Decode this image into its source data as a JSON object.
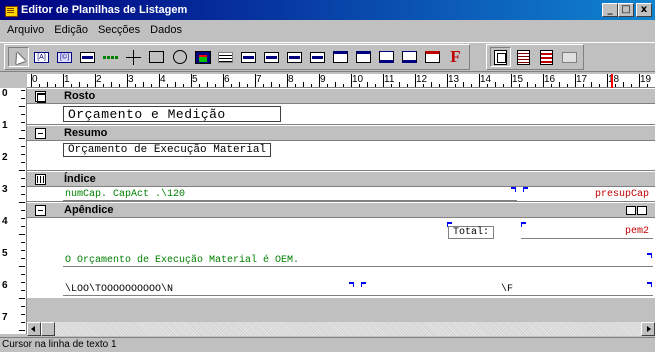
{
  "window": {
    "title": "Editor de Planilhas de Listagem",
    "minimize": "_",
    "maximize": "□",
    "close": "x"
  },
  "menu": [
    "Arquivo",
    "Edição",
    "Secções",
    "Dados"
  ],
  "toolbar": {
    "label_tool": "[A]",
    "field_tool": "[©]",
    "font_letter": "F"
  },
  "ruler": {
    "numbers": [
      "0",
      "1",
      "2",
      "3",
      "4",
      "5",
      "6",
      "7",
      "8",
      "9",
      "10",
      "11",
      "12",
      "13",
      "14",
      "15",
      "16",
      "17",
      "18",
      "19"
    ]
  },
  "vruler": {
    "numbers": [
      "0",
      "1",
      "2",
      "3",
      "4",
      "5",
      "6",
      "7"
    ]
  },
  "bands": {
    "rosto": {
      "title": "Rosto",
      "field": "Orçamento e Medição"
    },
    "resumo": {
      "title": "Resumo",
      "field": "Orçamento de Execução Material"
    },
    "indice": {
      "title": "Índice",
      "field_left": "numCap. CapAct .\\120",
      "field_right": "presupCap"
    },
    "apendice": {
      "title": "Apêndice",
      "total_label": "Total:",
      "total_value": "pem2",
      "note": "O Orçamento de Execução Material é OEM.",
      "row_left": "\\LOO\\TOOOOOOOOOO\\N",
      "row_right": "\\F"
    }
  },
  "status": {
    "text": "Cursor na linha de texto 1"
  }
}
